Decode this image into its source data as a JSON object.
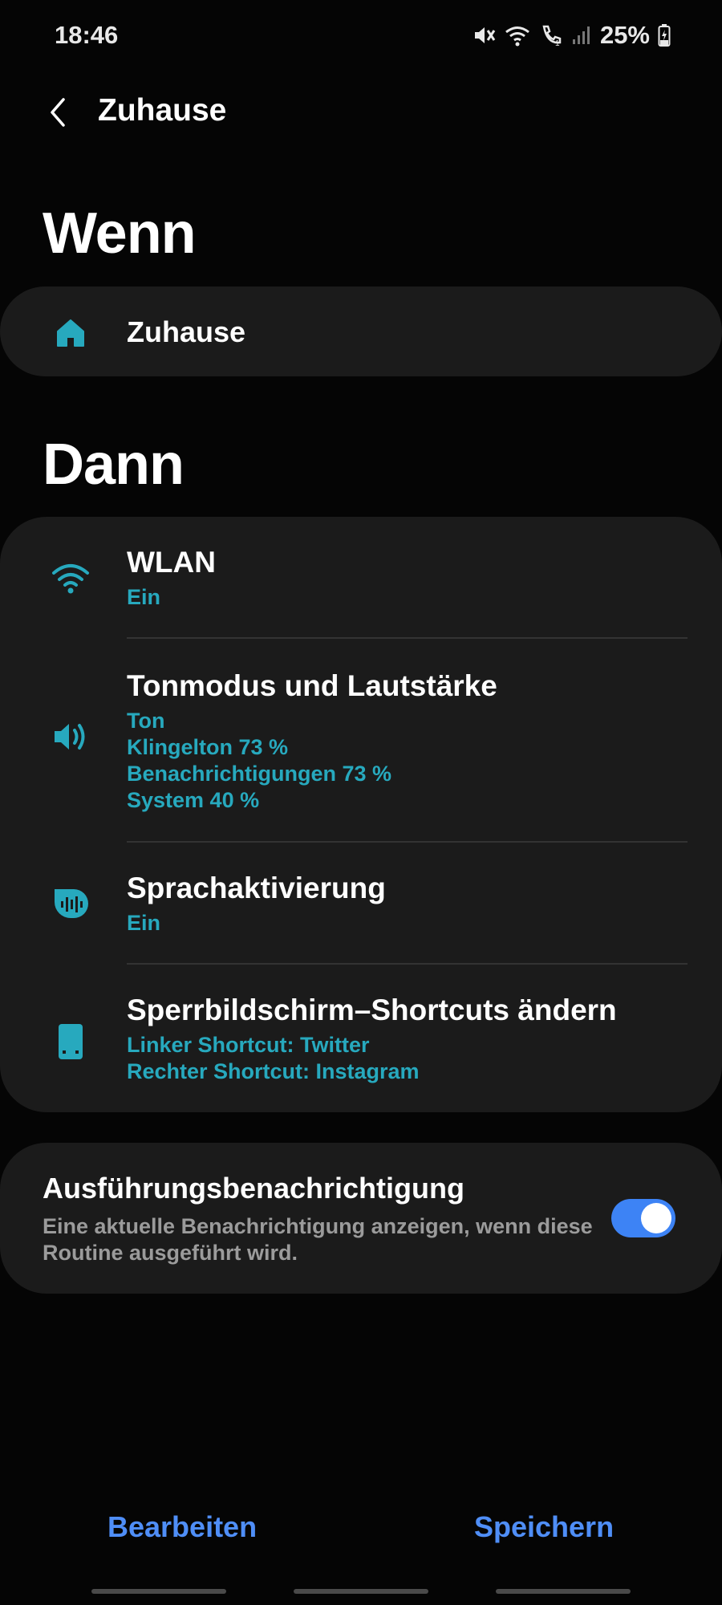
{
  "status": {
    "time": "18:46",
    "battery": "25%"
  },
  "header": {
    "title": "Zuhause"
  },
  "when": {
    "heading": "Wenn",
    "condition": "Zuhause"
  },
  "then": {
    "heading": "Dann",
    "actions": [
      {
        "title": "WLAN",
        "details": [
          "Ein"
        ]
      },
      {
        "title": "Tonmodus und Lautstärke",
        "details": [
          "Ton",
          "Klingelton 73 %",
          "Benachrichtigungen 73 %",
          "System 40 %"
        ]
      },
      {
        "title": "Sprachaktivierung",
        "details": [
          "Ein"
        ]
      },
      {
        "title": "Sperrbildschirm–Shortcuts ändern",
        "details": [
          "Linker Shortcut: Twitter",
          "Rechter Shortcut: Instagram"
        ]
      }
    ]
  },
  "notification": {
    "title": "Ausführungsbenachrichtigung",
    "description": "Eine aktuelle Benachrichtigung anzeigen, wenn diese Routine ausgeführt wird.",
    "enabled": true
  },
  "footer": {
    "edit_label": "Bearbeiten",
    "save_label": "Speichern"
  },
  "colors": {
    "accent": "#27a9be",
    "button": "#4f8ef7",
    "toggle": "#3d83f5"
  }
}
